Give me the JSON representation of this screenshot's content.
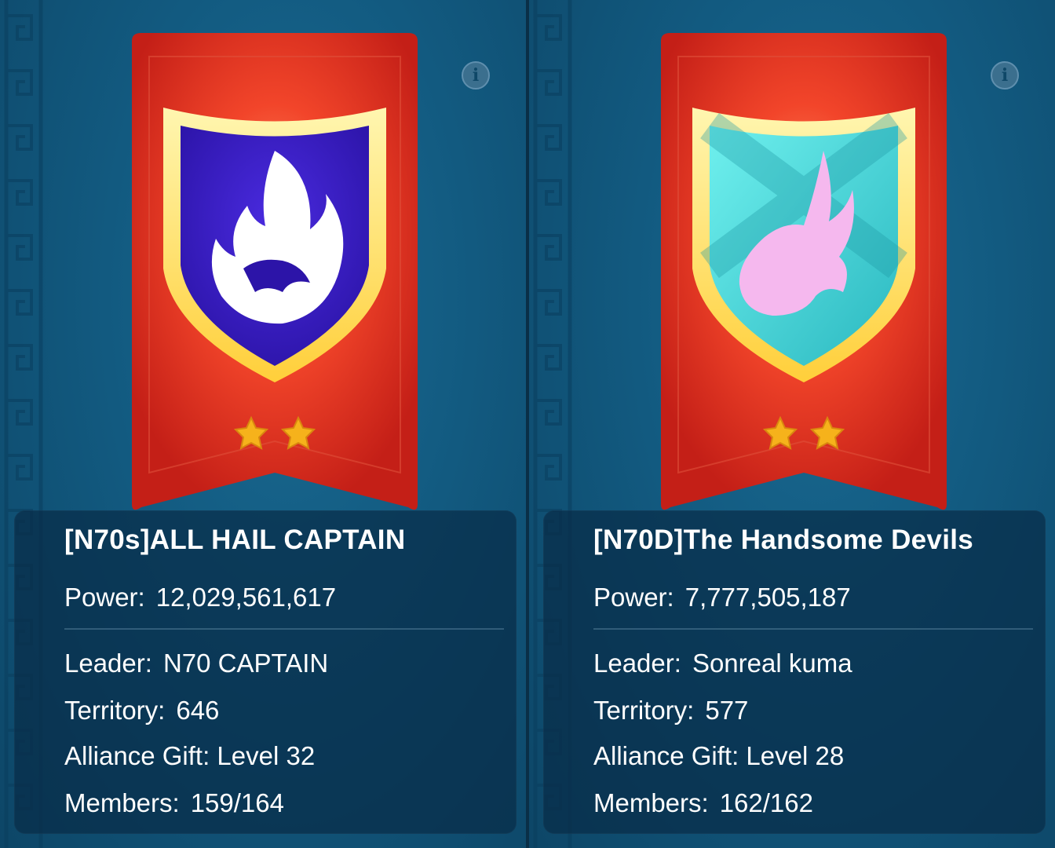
{
  "alliances": [
    {
      "name": "[N70s]ALL HAIL CAPTAIN",
      "power_label": "Power:",
      "power": "12,029,561,617",
      "leader_label": "Leader:",
      "leader": "N70 CAPTAIN",
      "territory_label": "Territory:",
      "territory": "646",
      "gift_label": "Alliance Gift:",
      "gift": "Level 32",
      "members_label": "Members:",
      "members": "159/164",
      "stars": 2,
      "emblem_icon": "dragon-flame-icon",
      "shield_color": "#3a1fc4",
      "emblem_color": "#ffffff"
    },
    {
      "name": "[N70D]The Handsome Devils",
      "power_label": "Power:",
      "power": "7,777,505,187",
      "leader_label": "Leader:",
      "leader": "Sonreal kuma",
      "territory_label": "Territory:",
      "territory": "577",
      "gift_label": "Alliance Gift:",
      "gift": "Level 28",
      "members_label": "Members:",
      "members": "162/162",
      "stars": 2,
      "emblem_icon": "bull-head-icon",
      "shield_color": "#2fd3d3",
      "emblem_color": "#f5b8ee"
    }
  ],
  "colors": {
    "banner_red": "#d8261c",
    "shield_gold": "#ffe36a",
    "star_gold": "#f6b21b",
    "background_blue": "#125a80"
  }
}
